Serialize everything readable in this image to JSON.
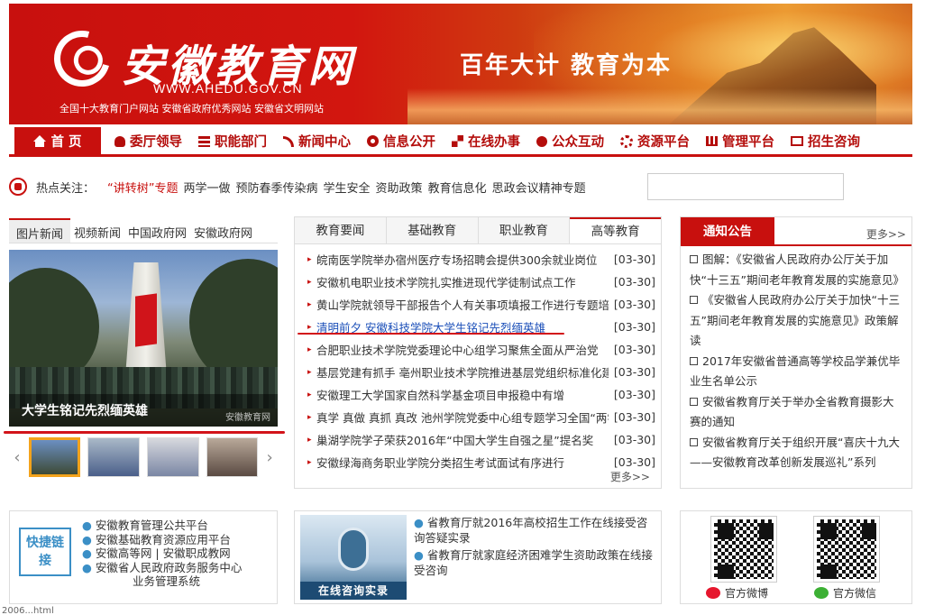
{
  "header": {
    "logo_text": "安徽教育网",
    "logo_url": "WWW.AHEDU.GOV.CN",
    "logo_sub": "全国十大教育门户网站  安徽省政府优秀网站  安徽省文明网站",
    "slogan": "百年大计   教育为本"
  },
  "nav": [
    {
      "label": "首 页",
      "icon": "home-icon"
    },
    {
      "label": "委厅领导",
      "icon": "person-icon"
    },
    {
      "label": "职能部门",
      "icon": "list-icon"
    },
    {
      "label": "新闻中心",
      "icon": "rss-icon"
    },
    {
      "label": "信息公开",
      "icon": "target-icon"
    },
    {
      "label": "在线办事",
      "icon": "grid-icon"
    },
    {
      "label": "公众互动",
      "icon": "hands-icon"
    },
    {
      "label": "资源平台",
      "icon": "gear-icon"
    },
    {
      "label": "管理平台",
      "icon": "chart-icon"
    },
    {
      "label": "招生咨询",
      "icon": "monitor-icon"
    }
  ],
  "hot": {
    "label": "热点关注：",
    "links": [
      "“讲转树”专题",
      "两学一做",
      "预防春季传染病",
      "学生安全",
      "资助政策",
      "教育信息化",
      "思政会议精神专题"
    ],
    "search_placeholder": ""
  },
  "photo": {
    "tabs": [
      "图片新闻",
      "视频新闻",
      "中国政府网",
      "安徽政府网"
    ],
    "caption": "大学生铭记先烈缅英雄",
    "watermark": "安徽教育网"
  },
  "news": {
    "tabs": [
      "教育要闻",
      "基础教育",
      "职业教育",
      "高等教育"
    ],
    "items": [
      {
        "title": "皖南医学院举办宿州医疗专场招聘会提供300余就业岗位",
        "date": "[03-30]"
      },
      {
        "title": "安徽机电职业技术学院扎实推进现代学徒制试点工作",
        "date": "[03-30]"
      },
      {
        "title": "黄山学院就领导干部报告个人有关事项填报工作进行专题培训",
        "date": "[03-30]"
      },
      {
        "title": "清明前夕 安徽科技学院大学生铭记先烈缅英雄",
        "date": "[03-30]"
      },
      {
        "title": "合肥职业技术学院党委理论中心组学习聚焦全面从严治党",
        "date": "[03-30]"
      },
      {
        "title": "基层党建有抓手 亳州职业技术学院推进基层党组织标准化建设",
        "date": "[03-30]"
      },
      {
        "title": "安徽理工大学国家自然科学基金项目申报稳中有增",
        "date": "[03-30]"
      },
      {
        "title": "真学 真做 真抓 真改 池州学院党委中心组专题学习全国“两学一做”",
        "date": "[03-30]"
      },
      {
        "title": "巢湖学院学子荣获2016年“中国大学生自强之星”提名奖",
        "date": "[03-30]"
      },
      {
        "title": "安徽绿海商务职业学院分类招生考试面试有序进行",
        "date": "[03-30]"
      }
    ],
    "more": "更多>>"
  },
  "notice": {
    "title": "通知公告",
    "more": "更多>>",
    "items": [
      "图解：《安徽省人民政府办公厅关于加快“十三五”期间老年教育发展的实施意见》",
      "《安徽省人民政府办公厅关于加快“十三五”期间老年教育发展的实施意见》政策解读",
      "2017年安徽省普通高等学校品学兼优毕业生名单公示",
      "安徽省教育厅关于举办全省教育摄影大赛的通知",
      "安徽省教育厅关于组织开展“喜庆十九大——安徽教育改革创新发展巡礼”系列"
    ]
  },
  "links": {
    "badge": "快捷链接",
    "items": [
      "安徽教育管理公共平台",
      "安徽基础教育资源应用平台",
      "安徽高等网 | 安徽职成教网",
      "安徽省人民政府政务服务中心",
      "业务管理系统"
    ]
  },
  "consult": {
    "image_label": "在线咨询实录",
    "items": [
      "省教育厅就2016年高校招生工作在线接受咨询答疑实录",
      "省教育厅就家庭经济困难学生资助政策在线接受咨询"
    ]
  },
  "social": {
    "weibo": "官方微博",
    "wechat": "官方微信"
  },
  "status": "2006...html"
}
